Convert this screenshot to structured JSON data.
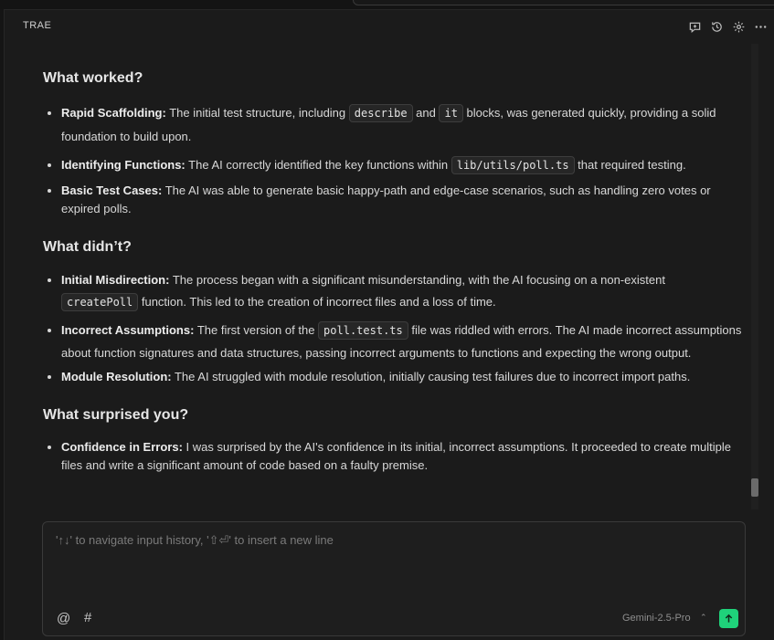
{
  "header": {
    "brand": "TRAE",
    "icons": [
      "new-chat-icon",
      "history-icon",
      "settings-icon",
      "more-icon"
    ]
  },
  "sections": [
    {
      "heading": "What worked?",
      "items": [
        {
          "bold": "Rapid Scaffolding:",
          "t1": " The initial test structure, including ",
          "c1": "describe",
          "t2": " and ",
          "c2": "it",
          "t3": " blocks, was generated quickly, providing a solid foundation to build upon."
        },
        {
          "bold": "Identifying Functions:",
          "t1": " The AI correctly identified the key functions within ",
          "c1": "lib/utils/poll.ts",
          "t2": " that required testing."
        },
        {
          "bold": "Basic Test Cases:",
          "t1": " The AI was able to generate basic happy-path and edge-case scenarios, such as handling zero votes or expired polls."
        }
      ]
    },
    {
      "heading": "What didn’t?",
      "items": [
        {
          "bold": "Initial Misdirection:",
          "t1": " The process began with a significant misunderstanding, with the AI focusing on a non-existent ",
          "c1": "createPoll",
          "t2": " function. This led to the creation of incorrect files and a loss of time."
        },
        {
          "bold": "Incorrect Assumptions:",
          "t1": " The first version of the ",
          "c1": "poll.test.ts",
          "t2": " file was riddled with errors. The AI made incorrect assumptions about function signatures and data structures, passing incorrect arguments to functions and expecting the wrong output."
        },
        {
          "bold": "Module Resolution:",
          "t1": " The AI struggled with module resolution, initially causing test failures due to incorrect import paths."
        }
      ]
    },
    {
      "heading": "What surprised you?",
      "items": [
        {
          "bold": "Confidence in Errors:",
          "t1": " I was surprised by the AI's confidence in its initial, incorrect assumptions. It proceeded to create multiple files and write a significant amount of code based on a faulty premise."
        }
      ]
    }
  ],
  "input": {
    "placeholder": "'↑↓' to navigate input history, '⇧⏎' to insert a new line",
    "at_symbol": "@",
    "hash_symbol": "#",
    "model": "Gemini-2.5-Pro",
    "chevron": "⌃"
  },
  "colors": {
    "accent": "#1fd27a",
    "background": "#1b1b1b"
  }
}
